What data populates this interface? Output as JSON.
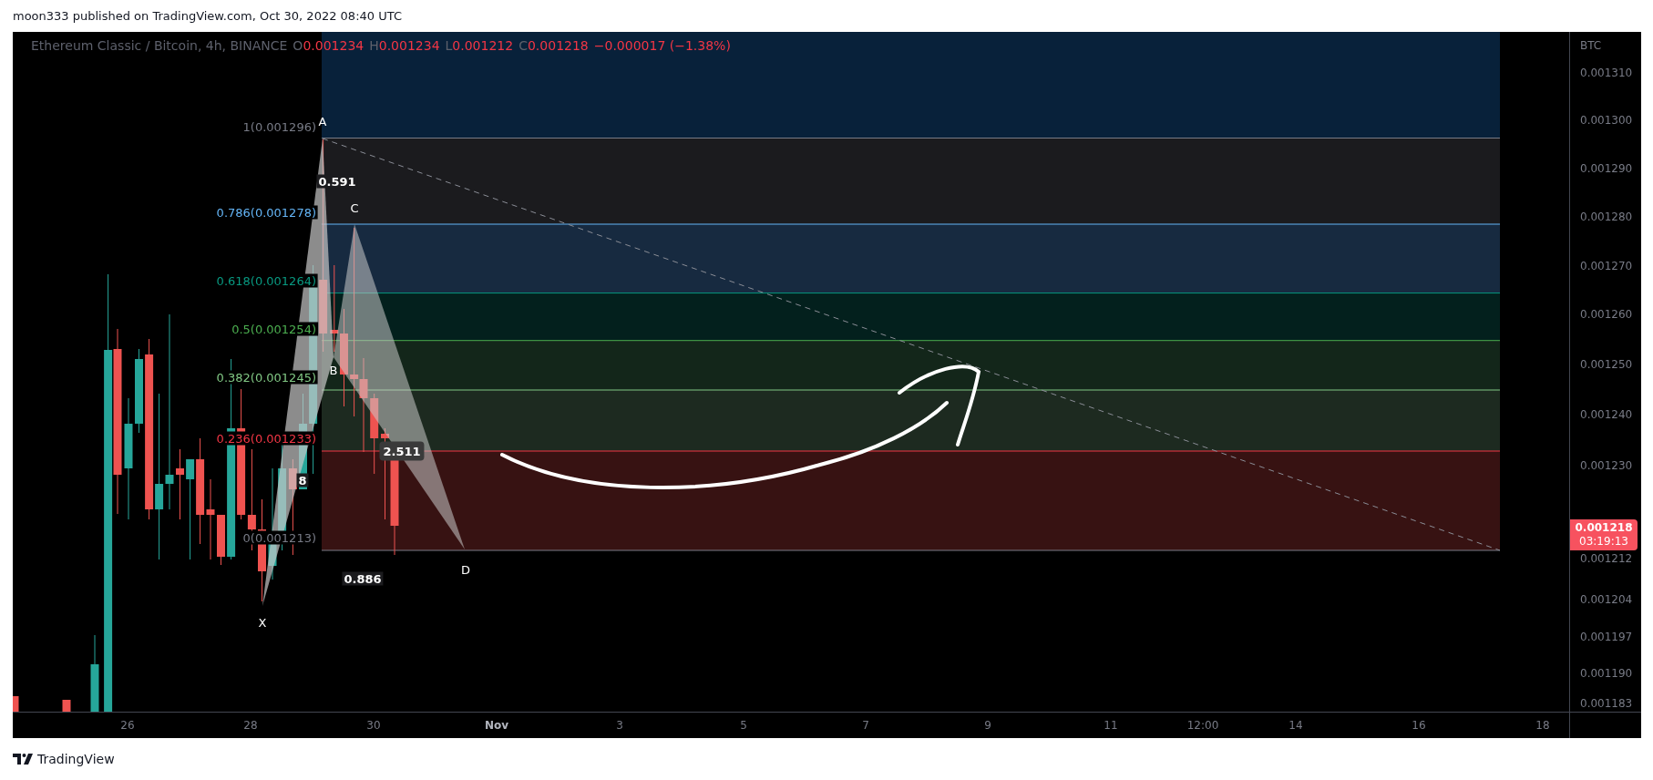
{
  "publish_line": "moon333 published on TradingView.com, Oct 30, 2022 08:40 UTC",
  "legend": {
    "symbol": "Ethereum Classic / Bitcoin, 4h, BINANCE",
    "values": [
      {
        "label": "O",
        "value": "0.001234"
      },
      {
        "label": "H",
        "value": "0.001234"
      },
      {
        "label": "L",
        "value": "0.001212"
      },
      {
        "label": "C",
        "value": "0.001218"
      }
    ],
    "change": "−0.000017 (−1.38%)"
  },
  "fib_levels": [
    {
      "label": "1(0.001296)",
      "color": "#787b86"
    },
    {
      "label": "0.786(0.001278)",
      "color": "#64b5f6"
    },
    {
      "label": "0.618(0.001264)",
      "color": "#089981"
    },
    {
      "label": "0.5(0.001254)",
      "color": "#4caf50"
    },
    {
      "label": "0.382(0.001245)",
      "color": "#81c784"
    },
    {
      "label": "0.236(0.001233)",
      "color": "#f23645"
    },
    {
      "label": "0(0.001213)",
      "color": "#787b86"
    }
  ],
  "pattern_points": [
    "A",
    "B",
    "C",
    "D",
    "X"
  ],
  "pattern_ratios": [
    {
      "text": "0.591",
      "boxed": false
    },
    {
      "text": "0.886",
      "boxed": false
    },
    {
      "text": "2.511",
      "boxed": true
    },
    {
      "text": "8",
      "boxed": false
    }
  ],
  "price_axis": {
    "unit": "BTC",
    "ticks": [
      "0.001310",
      "0.001300",
      "0.001290",
      "0.001280",
      "0.001270",
      "0.001260",
      "0.001250",
      "0.001240",
      "0.001230",
      "0.001212",
      "0.001204",
      "0.001197",
      "0.001190",
      "0.001183"
    ],
    "last_price": "0.001218",
    "countdown": "03:19:13"
  },
  "time_axis": [
    {
      "label": "26",
      "kind": "day"
    },
    {
      "label": "28",
      "kind": "day"
    },
    {
      "label": "30",
      "kind": "day"
    },
    {
      "label": "Nov",
      "kind": "month"
    },
    {
      "label": "3",
      "kind": "day"
    },
    {
      "label": "5",
      "kind": "day"
    },
    {
      "label": "7",
      "kind": "day"
    },
    {
      "label": "9",
      "kind": "day"
    },
    {
      "label": "11",
      "kind": "day"
    },
    {
      "label": "12:00",
      "kind": "day"
    },
    {
      "label": "14",
      "kind": "day"
    },
    {
      "label": "16",
      "kind": "day"
    },
    {
      "label": "18",
      "kind": "day"
    }
  ],
  "brand": "TradingView"
}
